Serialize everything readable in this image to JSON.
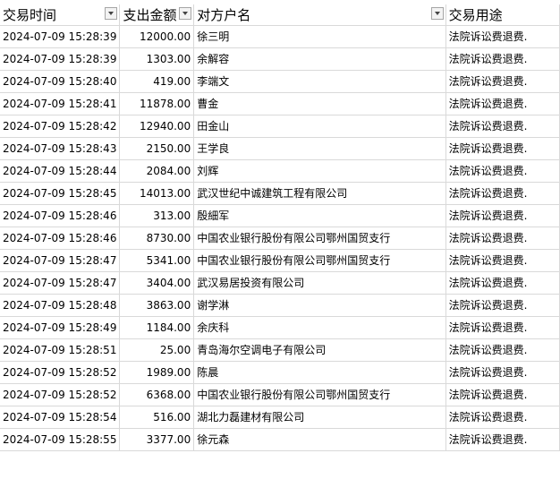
{
  "header": {
    "col_time": "交易时间",
    "col_amount": "支出金额",
    "col_party": "对方户名",
    "col_purpose": "交易用途"
  },
  "rows": [
    {
      "time": "2024-07-09 15:28:39",
      "amount": "12000.00",
      "party": "徐三明",
      "purpose": "法院诉讼费退费."
    },
    {
      "time": "2024-07-09 15:28:39",
      "amount": "1303.00",
      "party": "余解容",
      "purpose": "法院诉讼费退费."
    },
    {
      "time": "2024-07-09 15:28:40",
      "amount": "419.00",
      "party": "李端文",
      "purpose": "法院诉讼费退费."
    },
    {
      "time": "2024-07-09 15:28:41",
      "amount": "11878.00",
      "party": "曹金",
      "purpose": "法院诉讼费退费."
    },
    {
      "time": "2024-07-09 15:28:42",
      "amount": "12940.00",
      "party": "田金山",
      "purpose": "法院诉讼费退费."
    },
    {
      "time": "2024-07-09 15:28:43",
      "amount": "2150.00",
      "party": "王学良",
      "purpose": "法院诉讼费退费."
    },
    {
      "time": "2024-07-09 15:28:44",
      "amount": "2084.00",
      "party": "刘辉",
      "purpose": "法院诉讼费退费."
    },
    {
      "time": "2024-07-09 15:28:45",
      "amount": "14013.00",
      "party": "武汉世纪中诚建筑工程有限公司",
      "purpose": "法院诉讼费退费."
    },
    {
      "time": "2024-07-09 15:28:46",
      "amount": "313.00",
      "party": "殷細军",
      "purpose": "法院诉讼费退费."
    },
    {
      "time": "2024-07-09 15:28:46",
      "amount": "8730.00",
      "party": "中国农业银行股份有限公司鄂州国贸支行",
      "purpose": "法院诉讼费退费."
    },
    {
      "time": "2024-07-09 15:28:47",
      "amount": "5341.00",
      "party": "中国农业银行股份有限公司鄂州国贸支行",
      "purpose": "法院诉讼费退费."
    },
    {
      "time": "2024-07-09 15:28:47",
      "amount": "3404.00",
      "party": "武汉易居投资有限公司",
      "purpose": "法院诉讼费退费."
    },
    {
      "time": "2024-07-09 15:28:48",
      "amount": "3863.00",
      "party": "谢学淋",
      "purpose": "法院诉讼费退费."
    },
    {
      "time": "2024-07-09 15:28:49",
      "amount": "1184.00",
      "party": "余庆科",
      "purpose": "法院诉讼费退费."
    },
    {
      "time": "2024-07-09 15:28:51",
      "amount": "25.00",
      "party": "青岛海尔空调电子有限公司",
      "purpose": "法院诉讼费退费."
    },
    {
      "time": "2024-07-09 15:28:52",
      "amount": "1989.00",
      "party": "陈晨",
      "purpose": "法院诉讼费退费."
    },
    {
      "time": "2024-07-09 15:28:52",
      "amount": "6368.00",
      "party": "中国农业银行股份有限公司鄂州国贸支行",
      "purpose": "法院诉讼费退费."
    },
    {
      "time": "2024-07-09 15:28:54",
      "amount": "516.00",
      "party": "湖北力磊建材有限公司",
      "purpose": "法院诉讼费退费."
    },
    {
      "time": "2024-07-09 15:28:55",
      "amount": "3377.00",
      "party": "徐元森",
      "purpose": "法院诉讼费退费."
    }
  ]
}
